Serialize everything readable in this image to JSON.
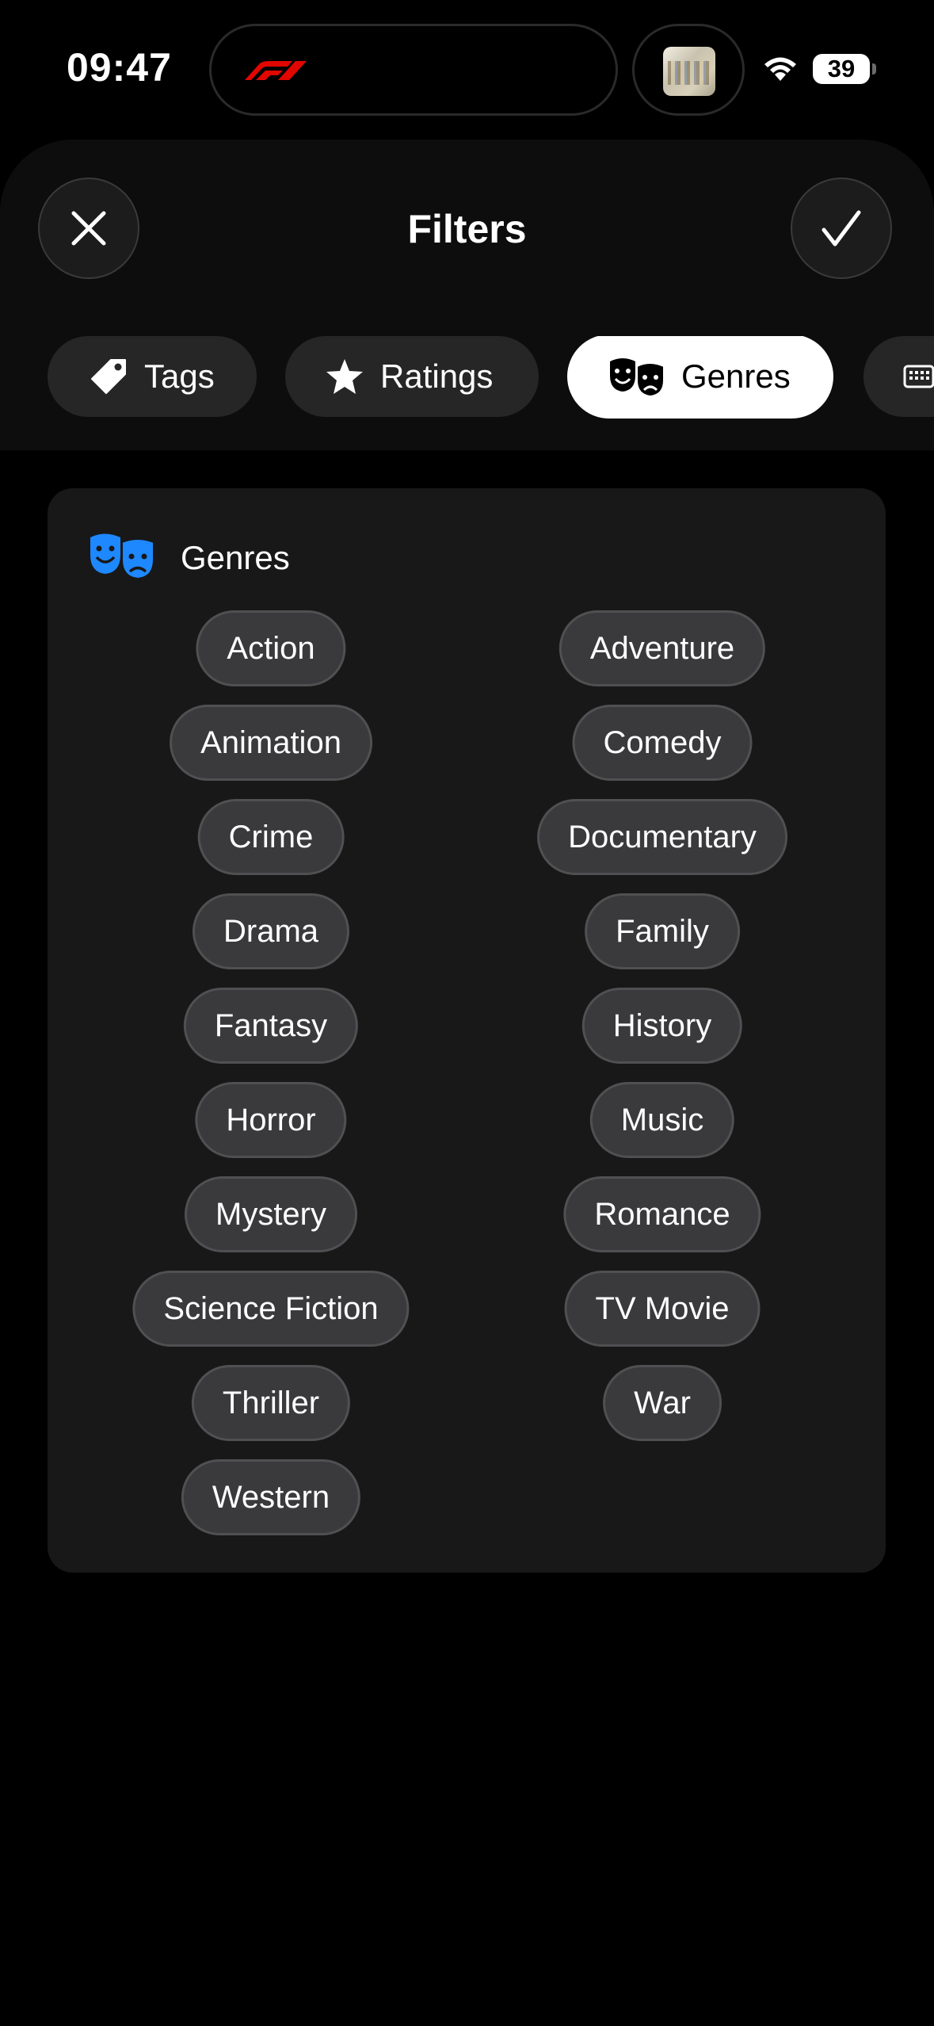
{
  "status_bar": {
    "time": "09:47",
    "battery": "39"
  },
  "header": {
    "title": "Filters"
  },
  "tabs": [
    {
      "label": "Tags",
      "icon": "tag-icon"
    },
    {
      "label": "Ratings",
      "icon": "star-icon"
    },
    {
      "label": "Genres",
      "icon": "theater-masks-icon",
      "active": true
    },
    {
      "label": "",
      "icon": "keyboard-icon"
    }
  ],
  "genres": {
    "title": "Genres",
    "accent": "#1e88ff",
    "left": [
      "Action",
      "Animation",
      "Crime",
      "Drama",
      "Fantasy",
      "Horror",
      "Mystery",
      "Science Fiction",
      "Thriller",
      "Western"
    ],
    "right": [
      "Adventure",
      "Comedy",
      "Documentary",
      "Family",
      "History",
      "Music",
      "Romance",
      "TV Movie",
      "War"
    ]
  }
}
